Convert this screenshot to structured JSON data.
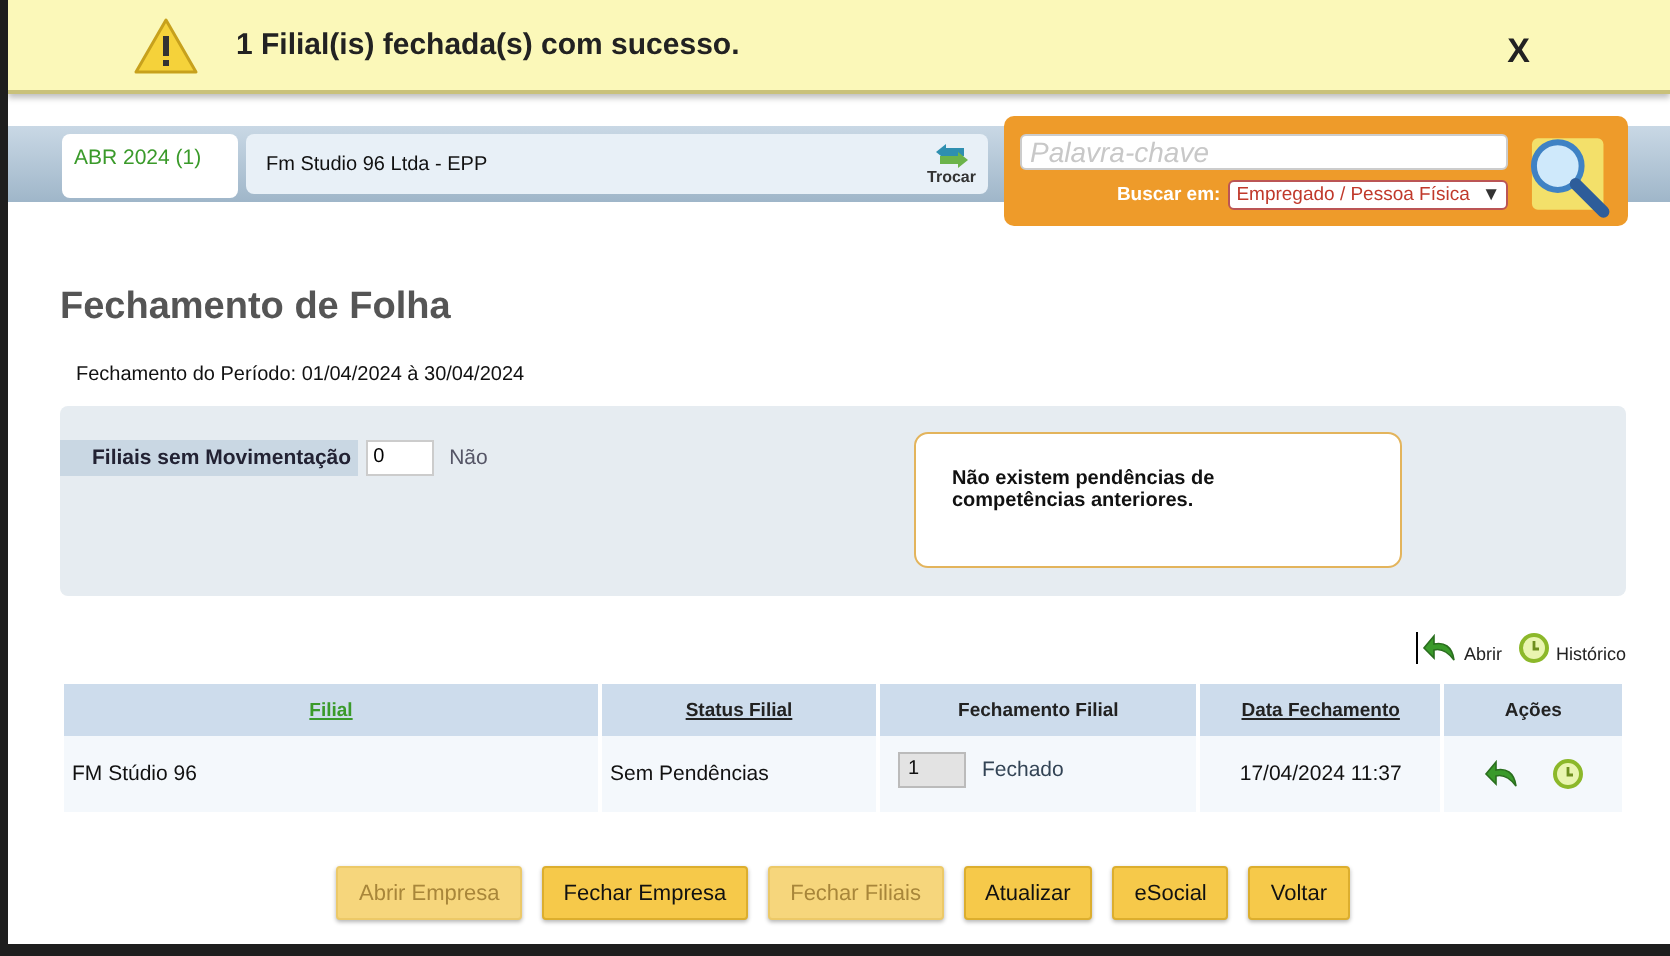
{
  "banner": {
    "message": "1 Filial(is) fechada(s) com sucesso.",
    "close": "X"
  },
  "header": {
    "period_tab": "ABR 2024 (1)",
    "company": "Fm Studio 96 Ltda - EPP",
    "swap_label": "Trocar",
    "search": {
      "placeholder": "Palavra-chave",
      "scope_label": "Buscar em:",
      "scope_value": "Empregado / Pessoa Física",
      "scope_arrow": "▼"
    }
  },
  "page": {
    "title": "Fechamento de Folha",
    "period": "Fechamento do Período: 01/04/2024 à 30/04/2024",
    "no_movement": {
      "label": "Filiais sem Movimentação",
      "value": "0",
      "answer": "Não"
    },
    "notice": "Não existem pendências de competências anteriores.",
    "legend": [
      {
        "kind": "open",
        "label": "Abrir"
      },
      {
        "kind": "history",
        "label": "Histórico"
      }
    ],
    "table": {
      "columns": [
        {
          "label": "Filial",
          "link": true
        },
        {
          "label": "Status Filial",
          "link": true
        },
        {
          "label": "Fechamento Filial",
          "link": false
        },
        {
          "label": "Data Fechamento",
          "link": true
        },
        {
          "label": "Ações",
          "link": false
        }
      ],
      "rows": [
        {
          "filial": "FM Stúdio 96",
          "status": "Sem Pendências",
          "count": "1",
          "closing": "Fechado",
          "date": "17/04/2024 11:37",
          "actions": [
            {
              "kind": "open"
            },
            {
              "kind": "history"
            }
          ]
        }
      ]
    },
    "buttons": [
      {
        "label": "Abrir Empresa",
        "disabled": true
      },
      {
        "label": "Fechar Empresa",
        "disabled": false
      },
      {
        "label": "Fechar Filiais",
        "disabled": true
      },
      {
        "label": "Atualizar",
        "disabled": false
      },
      {
        "label": "eSocial",
        "disabled": false
      },
      {
        "label": "Voltar",
        "disabled": false
      }
    ]
  }
}
